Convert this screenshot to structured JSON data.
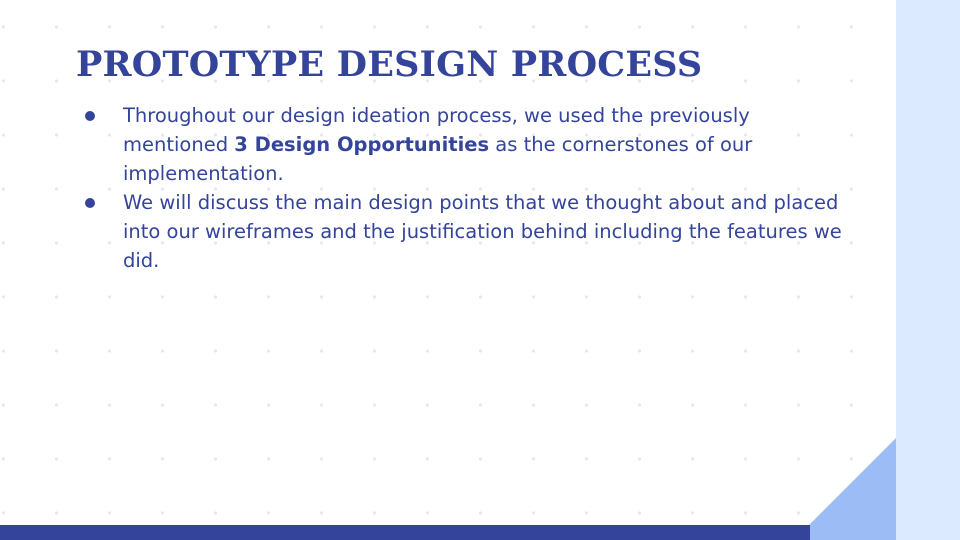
{
  "slide": {
    "title": "PROTOTYPE DESIGN PROCESS",
    "bullets": [
      {
        "before": "Throughout our design ideation process, we used the previously mentioned ",
        "bold": "3 Design Opportunities",
        "after": " as the cornerstones of our implementation."
      },
      {
        "text": "We will discuss the main design points that we thought about and placed into our wireframes and the justification behind including the features we did."
      }
    ]
  },
  "colors": {
    "text": "#34449a",
    "bottom_bar": "#34449a",
    "side_panel": "#dceaff",
    "triangle": "#9bbcf5",
    "background": "#ffffff"
  }
}
